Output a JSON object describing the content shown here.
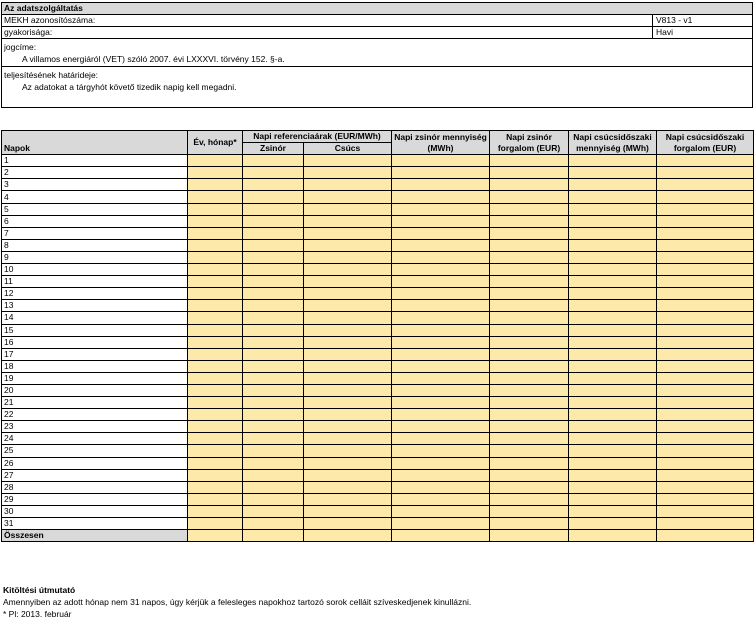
{
  "header": {
    "title": "Az adatszolgáltatás",
    "id_label": "MEKH azonosítószáma:",
    "id_value": "V813 - v1",
    "freq_label": "gyakorisága:",
    "freq_value": "Havi",
    "legal_label": "jogcíme:",
    "legal_text": "A villamos energiáról (VET) szóló 2007. évi LXXXVI. törvény 152. §-a.",
    "deadline_label": "teljesítésének határideje:",
    "deadline_text": "Az adatokat a tárgyhót követő tizedik napig kell megadni."
  },
  "table": {
    "col_day": "Napok",
    "col_year_month": "Év, hónap*",
    "col_ref_group": "Napi referenciaárak (EUR/MWh)",
    "col_base": "Zsinór",
    "col_peak": "Csúcs",
    "col_base_qty": "Napi zsinór mennyiség (MWh)",
    "col_base_turnover": "Napi zsinór forgalom (EUR)",
    "col_peak_qty": "Napi csúcsidőszaki mennyiség (MWh)",
    "col_peak_turnover": "Napi csúcsidőszaki forgalom (EUR)",
    "days": [
      "1",
      "2",
      "3",
      "4",
      "5",
      "6",
      "7",
      "8",
      "9",
      "10",
      "11",
      "12",
      "13",
      "14",
      "15",
      "16",
      "17",
      "18",
      "19",
      "20",
      "21",
      "22",
      "23",
      "24",
      "25",
      "26",
      "27",
      "28",
      "29",
      "30",
      "31"
    ],
    "total_label": "Összesen"
  },
  "footer": {
    "title": "Kitöltési útmutató",
    "note": "Amennyiben az adott hónap nem 31 napos, úgy kérjük a felesleges napokhoz tartozó sorok celláit szíveskedjenek kinullázni.",
    "example": "* Pl: 2013. február"
  },
  "colors": {
    "header_bg": "#d9d9d9",
    "input_bg": "#fde9a9"
  }
}
